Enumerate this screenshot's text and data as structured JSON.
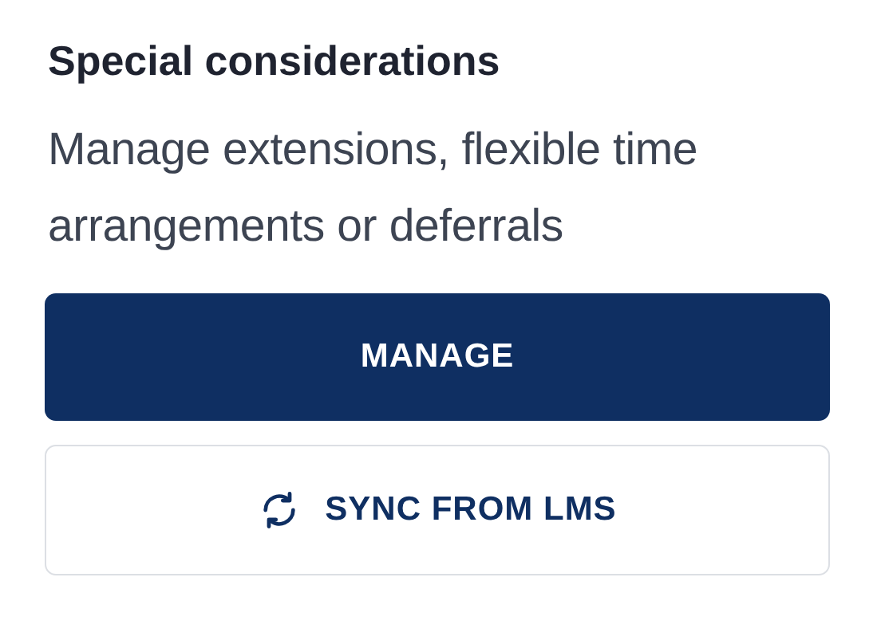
{
  "heading": "Special considerations",
  "description": "Manage extensions, flexible time arrangements or deferrals",
  "buttons": [
    {
      "kind": "primary",
      "label": "MANAGE"
    },
    {
      "kind": "secondary",
      "label": "SYNC FROM LMS"
    }
  ]
}
